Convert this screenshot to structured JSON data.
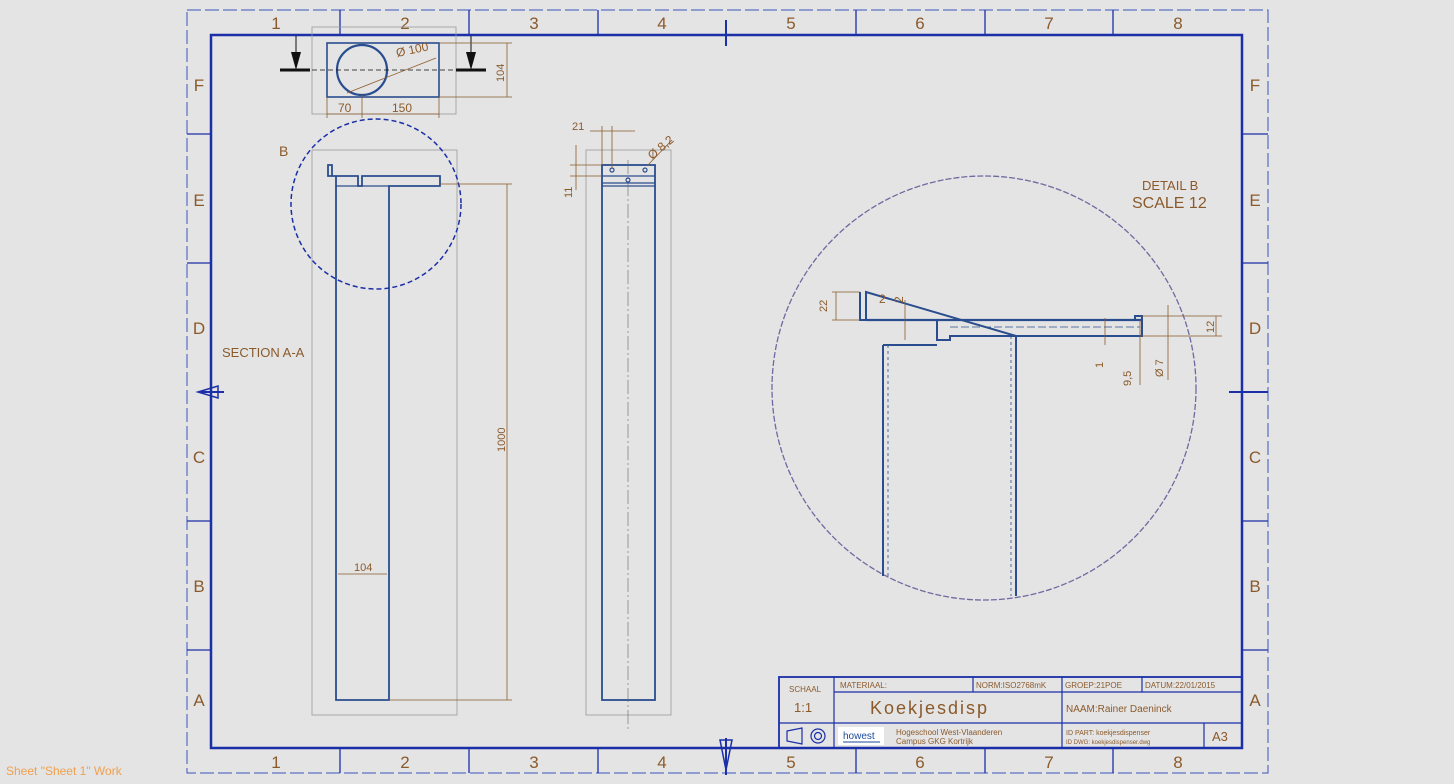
{
  "status_bar": {
    "text": "Sheet \"Sheet 1\" Work"
  },
  "frame": {
    "col_numbers": [
      "1",
      "2",
      "3",
      "4",
      "5",
      "6",
      "7",
      "8"
    ],
    "row_letters": [
      "F",
      "E",
      "D",
      "C",
      "B",
      "A"
    ]
  },
  "views": {
    "section_label": "SECTION A-A",
    "detail_ref": "B",
    "detail_title": "DETAIL B",
    "detail_scale": "SCALE 12"
  },
  "dimensions": {
    "top_diameter": "Ø 100",
    "top_height": "104",
    "top_left": "70",
    "top_width": "150",
    "side_height": "1000",
    "side_width": "104",
    "mid_21": "21",
    "mid_11": "11",
    "mid_hole": "Ø 8,2",
    "det_22": "22",
    "det_2a": "2",
    "det_2b": "2",
    "det_1": "1",
    "det_9_5": "9,5",
    "det_7": "Ø 7",
    "det_12": "12"
  },
  "title_block": {
    "schaal_label": "SCHAAL",
    "schaal_value": "1:1",
    "materiaal": "MATERIAAL:",
    "norm": "NORM:ISO2768mK",
    "groep": "GROEP:21POE",
    "datum": "DATUM:22/01/2015",
    "title": "Koekjesdisp",
    "naam": "NAAM:Rainer Daeninck",
    "logo_text": "howest",
    "school_line1": "Hogeschool West-Vlaanderen",
    "school_line2": "Campus GKG Kortrijk",
    "id_part": "ID PART: koekjesdispenser",
    "id_dwg": "ID DWG: koekjesdispenser.dwg",
    "sheet_size": "A3"
  },
  "colors": {
    "frame": "#1a2fa8",
    "part": "#2a4d8f",
    "dimension": "#8b5a2b",
    "detail_circle": "#6e6aa0"
  }
}
